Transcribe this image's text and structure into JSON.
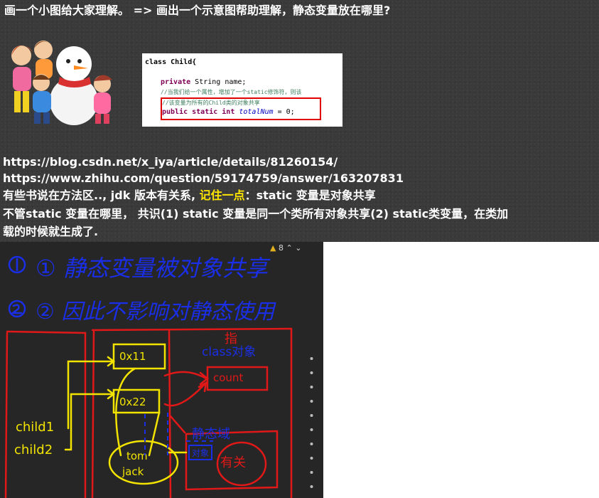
{
  "slide": {
    "heading": "画一个小图给大家理解。 => 画出一个示意图帮助理解，静态变量放在哪里?",
    "url1": "https://blog.csdn.net/x_iya/article/details/81260154/",
    "url2": "https://www.zhihu.com/question/59174759/answer/163207831",
    "line3_before": "有些书说在方法区.., jdk 版本有关系, ",
    "line3_highlight": "记住一点",
    "line3_after": "：static 变量是对象共享",
    "line4": "不管static 变量在哪里， 共识(1) static 变量是同一个类所有对象共享(2) static类变量，在类加",
    "line5": "载的时候就生成了."
  },
  "code": {
    "line1": "class Child{",
    "line2_kw": "private",
    "line2_rest": " String name;",
    "line3": "//当我们给一个属性，增加了一个static修饰符，则该",
    "line4": "//该变量为所有的Child类的对象共享",
    "line5_kw": "public static int ",
    "line5_var": "totalNum",
    "line5_rest": " = 0;"
  },
  "board": {
    "warning_count": "8",
    "handwriting_line1": "① 静态变量被对象共享",
    "handwriting_line2": "② 因此不影响对静态使用",
    "label_child1": "child1",
    "label_child2": "child2",
    "addr1": "0x11",
    "addr2": "0x22",
    "label_class_obj": "class对象",
    "label_count": "count",
    "label_static_area": "静态域",
    "label_tom": "tom",
    "label_jack": "jack",
    "label_obj": "对象",
    "label_related": "有关",
    "colors": {
      "blue": "#1a2ee6",
      "red": "#e01818",
      "yellow": "#f2e400"
    }
  }
}
